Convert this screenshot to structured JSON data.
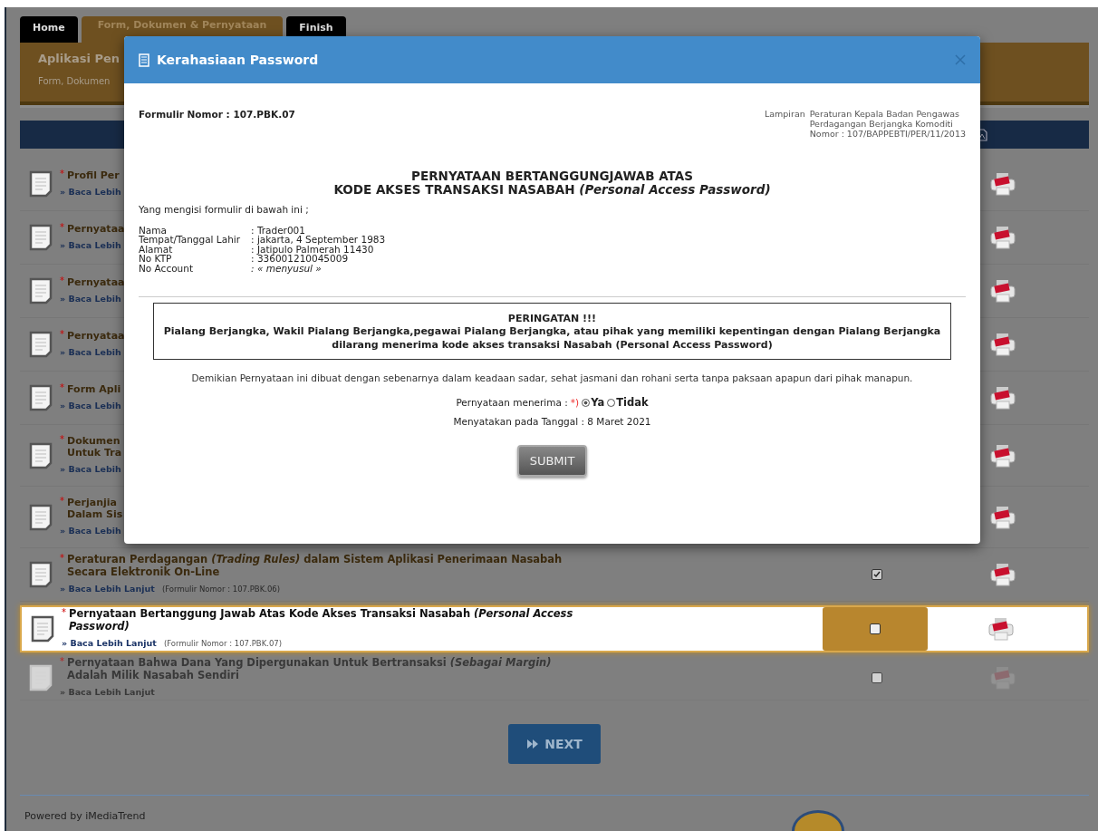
{
  "tabs": [
    {
      "label": "Home",
      "selected": false
    },
    {
      "label": "Form, Dokumen & Pernyataan",
      "selected": true
    },
    {
      "label": "Finish",
      "selected": false
    }
  ],
  "header": {
    "title": "Aplikasi Pen",
    "subtitle": "Form, Dokumen"
  },
  "documents": [
    {
      "required": "*",
      "title": "Profil Per",
      "link": "» Baca Lebih",
      "highlighted": false,
      "disabled": false
    },
    {
      "required": "*",
      "title": "Pernyataa",
      "link": "» Baca Lebih",
      "highlighted": false,
      "disabled": false
    },
    {
      "required": "*",
      "title": "Pernyataa",
      "link": "» Baca Lebih",
      "highlighted": false,
      "disabled": false
    },
    {
      "required": "*",
      "title": "Pernyataa",
      "link": "» Baca Lebih",
      "highlighted": false,
      "disabled": false
    },
    {
      "required": "*",
      "title": "Form Apli",
      "link": "» Baca Lebih",
      "highlighted": false,
      "disabled": false
    },
    {
      "required": "*",
      "title": "Dokumen\nUntuk Tra",
      "link": "» Baca Lebih",
      "highlighted": false,
      "disabled": false
    },
    {
      "required": "*",
      "title": "Perjanjia\nDalam Sis",
      "link": "» Baca Lebih",
      "highlighted": false,
      "disabled": false
    },
    {
      "required": "*",
      "title": "Peraturan Perdagangan *(Trading Rules)* dalam Sistem Aplikasi Penerimaan Nasabah Secara Elektronik On-Line",
      "link": "» Baca Lebih Lanjut",
      "note": "(Formulir Nomor : 107.PBK.06)",
      "checked": true,
      "highlighted": false,
      "disabled": false
    },
    {
      "required": "*",
      "title": "Pernyataan Bertanggung Jawab Atas Kode Akses Transaksi Nasabah *(Personal Access Password)*",
      "link": "» Baca Lebih Lanjut",
      "note": "(Formulir Nomor : 107.PBK.07)",
      "checked": false,
      "highlighted": true,
      "disabled": false
    },
    {
      "required": "*",
      "title": "Pernyataan Bahwa Dana Yang Dipergunakan Untuk Bertransaksi *(Sebagai Margin)* Adalah Milik Nasabah Sendiri",
      "link": "» Baca Lebih Lanjut",
      "checked": false,
      "highlighted": false,
      "disabled": true
    }
  ],
  "next_button": "NEXT",
  "footer": {
    "powered": "Powered by iMediaTrend"
  },
  "modal": {
    "title": "Kerahasiaan Password",
    "form_number": "Formulir Nomor : 107.PBK.07",
    "attachment_label": "Lampiran",
    "attachment_lines": [
      "Peraturan Kepala Badan Pengawas",
      "Perdagangan Berjangka Komoditi",
      "Nomor : 107/BAPPEBTI/PER/11/2013"
    ],
    "heading": [
      "PERNYATAAN BERTANGGUNGJAWAB ATAS",
      "KODE AKSES TRANSAKSI NASABAH *(Personal Access Password)*"
    ],
    "intro": "Yang mengisi formulir di bawah ini ;",
    "fields": [
      {
        "label": "Nama",
        "value": ": Trader001",
        "italic": false
      },
      {
        "label": "Tempat/Tanggal Lahir",
        "value": ": jakarta, 4 September 1983",
        "italic": false
      },
      {
        "label": "Alamat",
        "value": ": Jatipulo Palmerah 11430",
        "italic": false
      },
      {
        "label": "No KTP",
        "value": ": 336001210045009",
        "italic": false
      },
      {
        "label": "No Account",
        "value": ": « menyusul »",
        "italic": true
      }
    ],
    "warning": {
      "title": "PERINGATAN !!!",
      "text": "Pialang Berjangka, Wakil Pialang Berjangka,pegawai Pialang Berjangka, atau pihak yang memiliki kepentingan dengan Pialang Berjangka dilarang menerima kode akses transaksi Nasabah (Personal Access Password)"
    },
    "statement": "Demikian Pernyataan ini dibuat dengan sebenarnya dalam keadaan sadar, sehat jasmani dan rohani serta tanpa paksaan apapun dari pihak manapun.",
    "consent": {
      "label": "Pernyataan menerima :",
      "required": "*)",
      "options": [
        {
          "label": "Ya",
          "selected": true
        },
        {
          "label": "Tidak",
          "selected": false
        }
      ]
    },
    "date": "Menyatakan pada Tanggal : 8 Maret 2021",
    "submit": "SUBMIT"
  }
}
